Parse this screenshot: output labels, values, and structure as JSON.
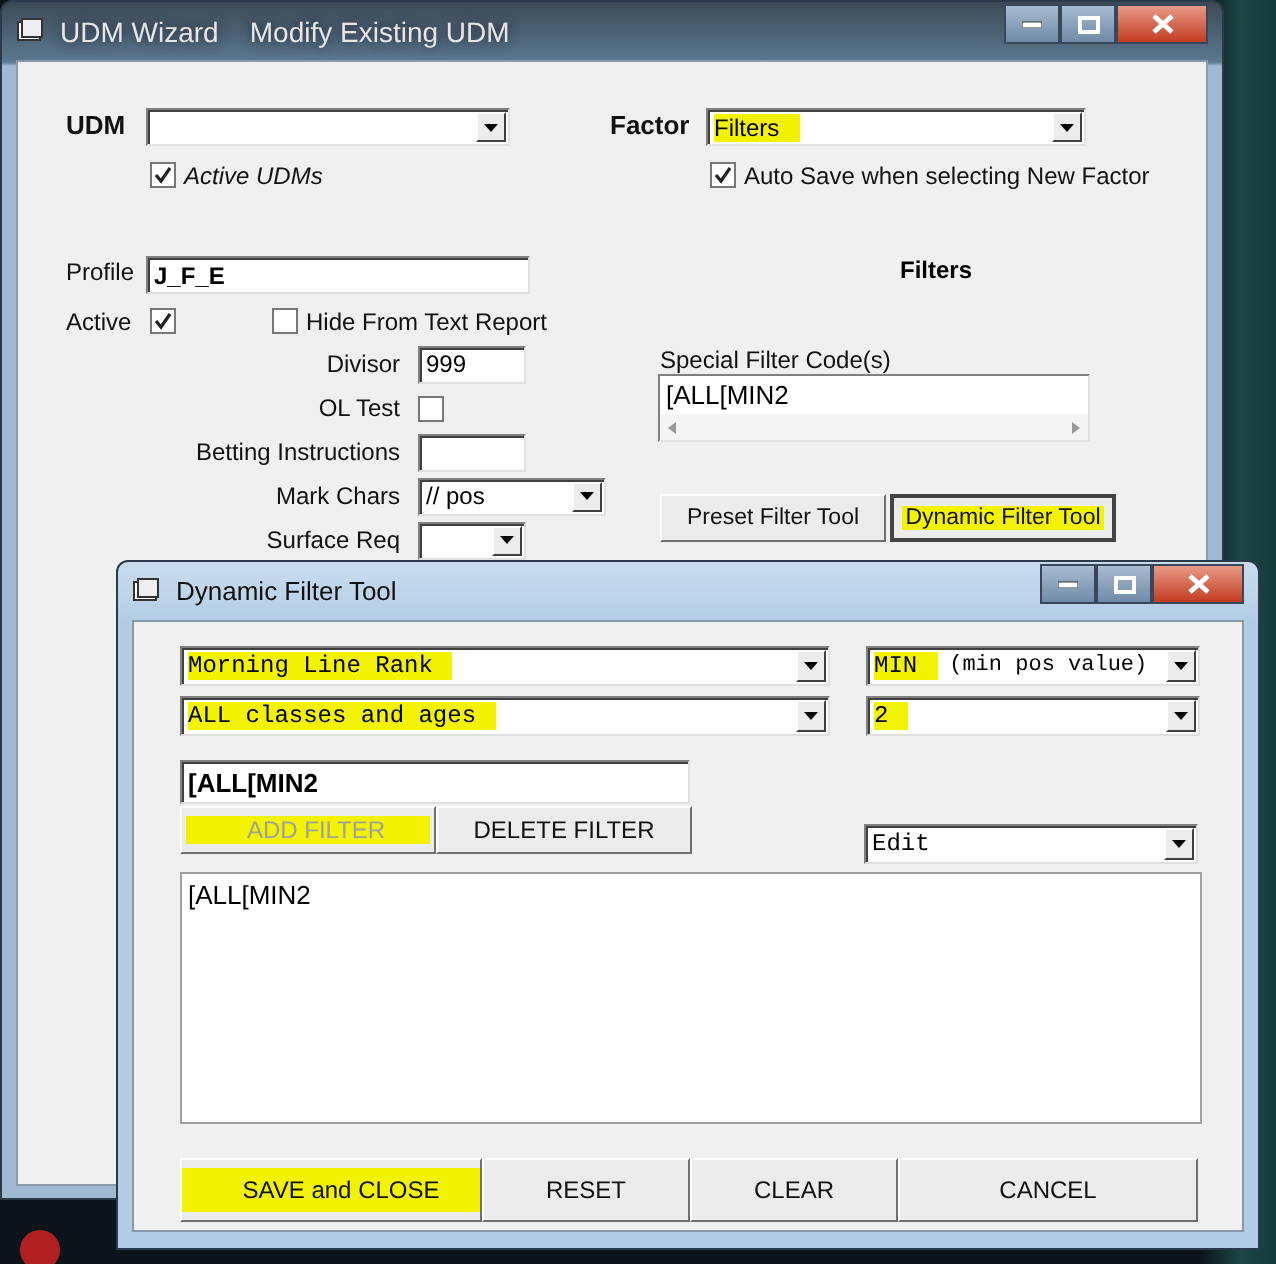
{
  "main_window": {
    "title": "UDM Wizard    Modify Existing UDM",
    "udm": {
      "label": "UDM"
    },
    "active_udms": {
      "label": "Active UDMs",
      "checked": true
    },
    "factor": {
      "label": "Factor",
      "value": "Filters",
      "highlighted": true
    },
    "auto_save": {
      "label": "Auto Save when selecting New Factor",
      "checked": true
    },
    "profile": {
      "label": "Profile",
      "value": "J_F_E"
    },
    "filters_heading": "Filters",
    "active": {
      "label": "Active",
      "checked": true
    },
    "hide_from_text_report": {
      "label": "Hide From Text Report",
      "checked": false
    },
    "divisor": {
      "label": "Divisor",
      "value": "999"
    },
    "ol_test": {
      "label": "OL Test",
      "checked": false
    },
    "betting_instructions": {
      "label": "Betting Instructions"
    },
    "mark_chars": {
      "label": "Mark Chars",
      "value": "// pos"
    },
    "surface_req": {
      "label": "Surface Req"
    },
    "special_filter_codes": {
      "label": "Special Filter Code(s)",
      "value": "[ALL[MIN2"
    },
    "tool_buttons": [
      {
        "label": "Preset Filter Tool",
        "selected": false,
        "highlighted": false
      },
      {
        "label": "Dynamic Filter Tool",
        "selected": true,
        "highlighted": true
      }
    ]
  },
  "dialog": {
    "title": "Dynamic Filter Tool",
    "factor_select": {
      "value": "Morning Line Rank",
      "highlighted": true
    },
    "operator_select": {
      "value": "MIN",
      "note": "(min pos value)",
      "highlighted": true
    },
    "class_select": {
      "value": "ALL classes and ages",
      "highlighted": true
    },
    "operand_select": {
      "value": "2",
      "highlighted": true
    },
    "filter_code": {
      "value": "[ALL[MIN2"
    },
    "filter_buttons": [
      {
        "label": "ADD FILTER",
        "disabled": true,
        "highlighted": true
      },
      {
        "label": "DELETE FILTER",
        "disabled": false,
        "highlighted": false
      }
    ],
    "mode_select": {
      "value": "Edit"
    },
    "filter_text": {
      "value": "[ALL[MIN2"
    },
    "buttons": [
      {
        "label": "SAVE and CLOSE",
        "highlighted": true
      },
      {
        "label": "RESET",
        "highlighted": false
      },
      {
        "label": "CLEAR",
        "highlighted": false
      },
      {
        "label": "CANCEL",
        "highlighted": false
      }
    ]
  }
}
